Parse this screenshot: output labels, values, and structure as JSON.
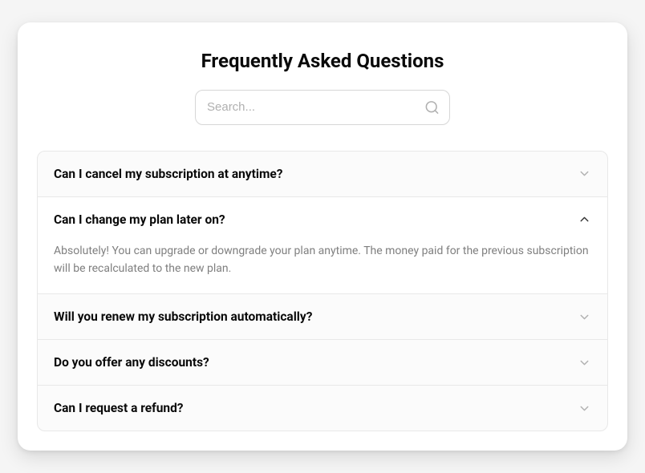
{
  "title": "Frequently Asked Questions",
  "search": {
    "placeholder": "Search..."
  },
  "faq": {
    "items": [
      {
        "question": "Can I cancel my subscription at anytime?",
        "expanded": false,
        "answer": ""
      },
      {
        "question": "Can I change my plan later on?",
        "expanded": true,
        "answer": "Absolutely! You can upgrade or downgrade your plan anytime. The money paid for the previous subscription will be recalculated to the new plan."
      },
      {
        "question": "Will you renew my subscription automatically?",
        "expanded": false,
        "answer": ""
      },
      {
        "question": "Do you offer any discounts?",
        "expanded": false,
        "answer": ""
      },
      {
        "question": "Can I request a refund?",
        "expanded": false,
        "answer": ""
      }
    ]
  }
}
